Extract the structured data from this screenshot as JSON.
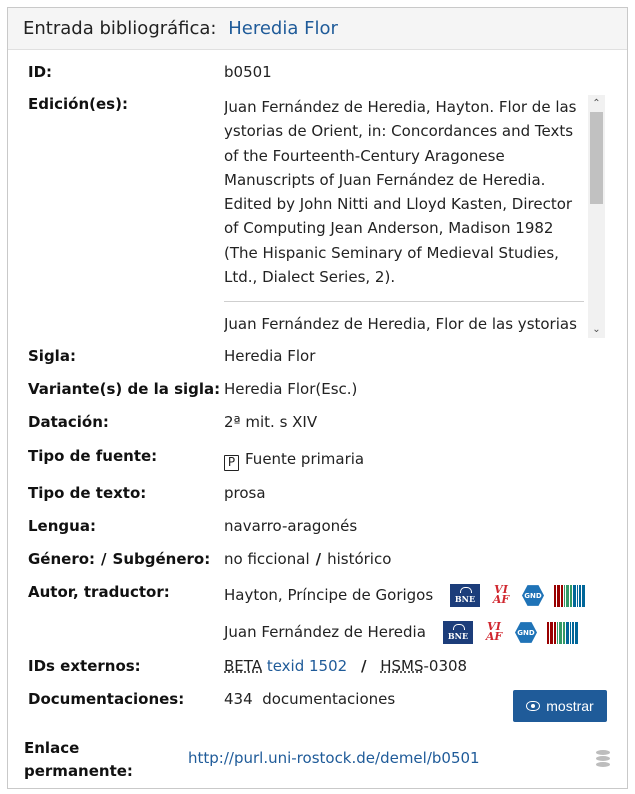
{
  "header": {
    "label": "Entrada bibliográfica:",
    "value": "Heredia Flor"
  },
  "fields": {
    "id": {
      "label": "ID:",
      "value": "b0501"
    },
    "ediciones": {
      "label": "Edición(es):",
      "items": [
        "Juan Fernández de Heredia, Hayton. Flor de las ystorias de Orient, in: Concordances and Texts of the Fourteenth-Century Aragonese Manuscripts of Juan Fernández de Heredia. Edited by John Nitti and Lloyd Kasten, Director of Computing Jean Anderson, Madison 1982 (The Hispanic Seminary of Medieval Studies, Ltd., Dialect Series, 2).",
        "Juan Fernández de Heredia, Flor de las ystorias"
      ]
    },
    "sigla": {
      "label": "Sigla:",
      "value": "Heredia Flor"
    },
    "variantes": {
      "label": "Variante(s) de la sigla:",
      "value": "Heredia Flor(Esc.)"
    },
    "datacion": {
      "label": "Datación:",
      "value": "2ª mit. s XIV"
    },
    "tipo_fuente": {
      "label": "Tipo de fuente:",
      "icon_letter": "P",
      "value": "Fuente primaria"
    },
    "tipo_texto": {
      "label": "Tipo de texto:",
      "value": "prosa"
    },
    "lengua": {
      "label": "Lengua:",
      "value": "navarro-aragonés"
    },
    "genero": {
      "label_genero": "Género:",
      "label_subgenero": "Subgénero:",
      "separator": "/",
      "genero": "no ficcional",
      "subgenero": "histórico"
    },
    "autor": {
      "label": "Autor, traductor:",
      "persons": [
        {
          "name": "Hayton, Príncipe de Gorigos",
          "badges": [
            "BNE",
            "VIAF",
            "GND"
          ]
        },
        {
          "name": "Juan Fernández de Heredia",
          "badges": [
            "BNE",
            "VIAF",
            "GND"
          ]
        }
      ]
    },
    "ids_externos": {
      "label": "IDs externos:",
      "beta": "BETA",
      "texid": "texid 1502",
      "separator": "/",
      "hsms": "HSMS",
      "hsms_num": "-0308"
    },
    "documentaciones": {
      "label": "Documentaciones:",
      "count": "434",
      "text": "documentaciones",
      "button": "mostrar"
    }
  },
  "footer": {
    "label": "Enlace permanente:",
    "url": "http://purl.uni-rostock.de/demel/b0501"
  },
  "colors": {
    "link": "#1f5b99",
    "button_bg": "#1f5b99",
    "bne": "#1c3d7a",
    "viaf": "#d0272f",
    "gnd": "#1f73b7"
  },
  "icons": [
    "p-source-icon",
    "bne-icon",
    "viaf-icon",
    "gnd-icon",
    "wikidata-icon",
    "eye-icon",
    "database-icon",
    "scroll-up-icon",
    "scroll-down-icon"
  ]
}
